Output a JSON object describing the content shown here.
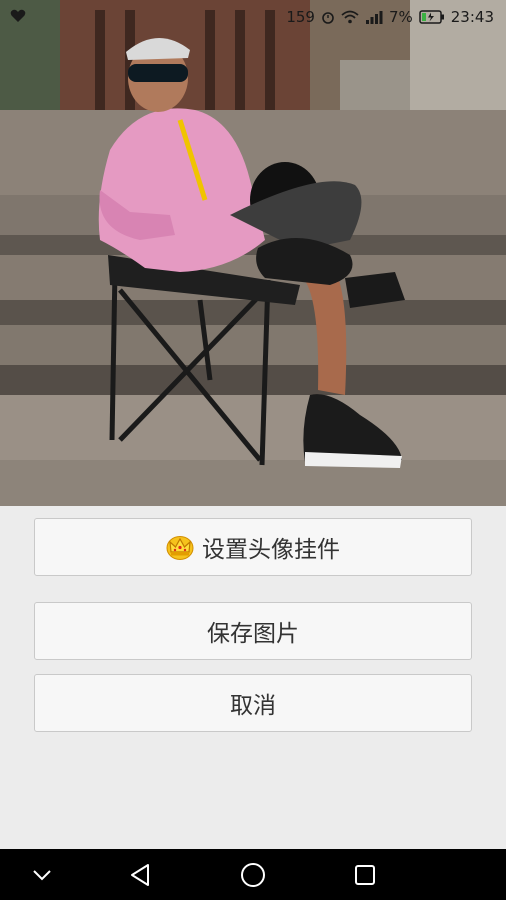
{
  "status_bar": {
    "left_icon": "notification-heart-icon",
    "speed_text": "159",
    "battery_text": "7%",
    "time": "23:43",
    "icons": [
      "alarm-icon",
      "wifi-icon",
      "signal-icon",
      "battery-icon"
    ]
  },
  "photo": {
    "description_icon": "photo-preview"
  },
  "action_sheet": {
    "avatar_pendant_label": "设置头像挂件",
    "avatar_pendant_icon": "crown-icon",
    "save_picture_label": "保存图片",
    "cancel_label": "取消"
  },
  "nav_bar": {
    "keys": [
      "hide-keyboard-icon",
      "back-icon",
      "home-icon",
      "recent-apps-icon"
    ]
  },
  "colors": {
    "sheet_bg": "#ececec",
    "button_bg": "#f7f7f7",
    "button_border": "#c9c9c9",
    "nav_bg": "#000000",
    "crown_gold": "#f2b600"
  }
}
